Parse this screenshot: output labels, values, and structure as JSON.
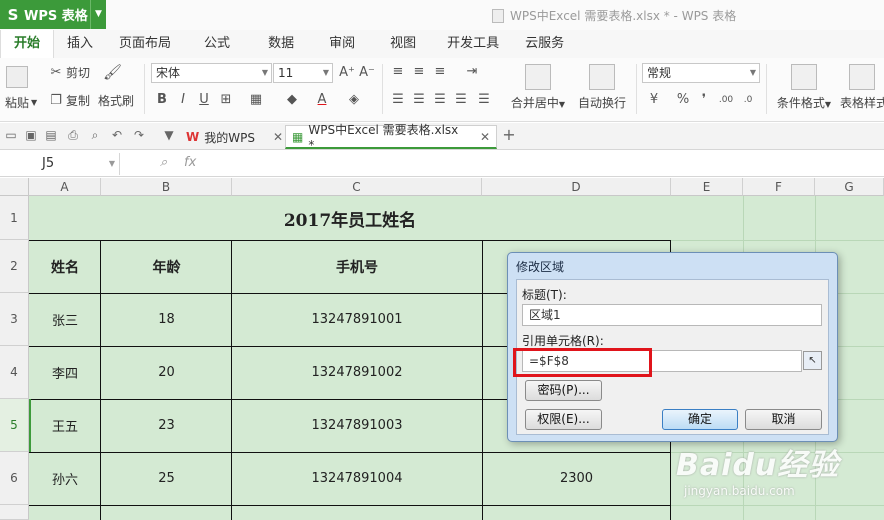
{
  "app": {
    "name": "WPS 表格",
    "window_title": "WPS中Excel 需要表格.xlsx * - WPS 表格"
  },
  "ribbon_tabs": [
    "开始",
    "插入",
    "页面布局",
    "公式",
    "数据",
    "审阅",
    "视图",
    "开发工具",
    "云服务"
  ],
  "ribbon": {
    "paste": "粘贴",
    "cut": "剪切",
    "copy": "复制",
    "format_painter": "格式刷",
    "font_name": "宋体",
    "font_size": "11",
    "merge_center": "合并居中",
    "wrap_text": "自动换行",
    "number_format": "常规",
    "conditional_format": "条件格式",
    "table_style": "表格样式"
  },
  "doc_tabs": [
    {
      "label": "我的WPS",
      "active": false
    },
    {
      "label": "WPS中Excel 需要表格.xlsx *",
      "active": true
    }
  ],
  "formula_bar": {
    "name_box": "J5",
    "fx": "fx"
  },
  "columns": [
    "A",
    "B",
    "C",
    "D",
    "E",
    "F",
    "G"
  ],
  "rows": [
    "1",
    "2",
    "3",
    "4",
    "5",
    "6"
  ],
  "selected_row": "5",
  "sheet": {
    "title": "2017年员工姓名",
    "headers": [
      "姓名",
      "年龄",
      "手机号"
    ],
    "records": [
      {
        "name": "张三",
        "age": "18",
        "phone": "13247891001",
        "d": ""
      },
      {
        "name": "李四",
        "age": "20",
        "phone": "13247891002",
        "d": ""
      },
      {
        "name": "王五",
        "age": "23",
        "phone": "13247891003",
        "d": ""
      },
      {
        "name": "孙六",
        "age": "25",
        "phone": "13247891004",
        "d": "2300"
      }
    ]
  },
  "dialog": {
    "title": "修改区域",
    "title_label": "标题(T):",
    "title_value": "区域1",
    "ref_label": "引用单元格(R):",
    "ref_value": "=$F$8",
    "password_btn": "密码(P)...",
    "permission_btn": "权限(E)...",
    "ok_btn": "确定",
    "cancel_btn": "取消"
  },
  "watermark": {
    "brand": "Baidu经验",
    "url": "jingyan.baidu.com"
  },
  "colors": {
    "accent_green": "#3c9a3a",
    "cell_fill": "#d4ead3",
    "highlight_red": "#e0141b"
  }
}
